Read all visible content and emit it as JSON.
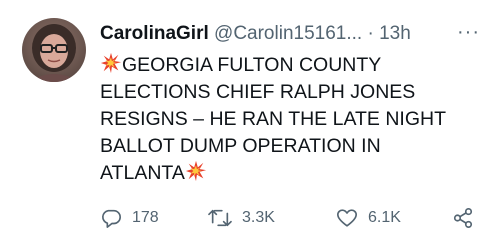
{
  "tweet": {
    "display_name": "CarolinaGirl",
    "handle": "@Carolin15161...",
    "separator": "·",
    "time": "13h",
    "more": "···",
    "text_lines": [
      "GEORGIA FULTON COUNTY",
      "ELECTIONS CHIEF RALPH JONES",
      "RESIGNS – HE RAN THE LATE NIGHT",
      "BALLOT DUMP OPERATION IN",
      "ATLANTA"
    ],
    "counts": {
      "replies": "178",
      "retweets": "3.3K",
      "likes": "6.1K"
    }
  },
  "icons": {
    "burst": "collision-emoji-icon",
    "reply": "reply-icon",
    "retweet": "retweet-icon",
    "like": "heart-icon",
    "share": "share-icon"
  },
  "colors": {
    "text": "#0f1419",
    "secondary": "#536471",
    "burst_red": "#e8412c",
    "burst_yellow": "#ffc83d"
  }
}
